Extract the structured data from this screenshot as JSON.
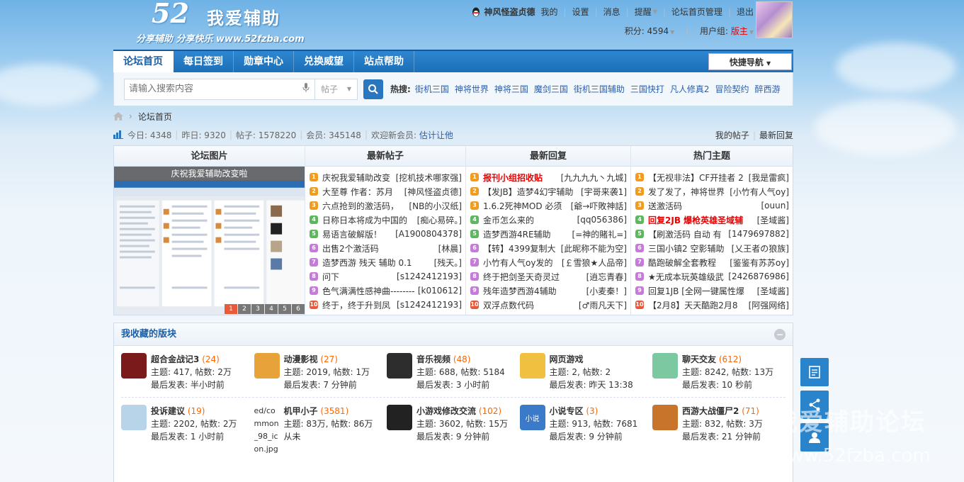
{
  "header": {
    "logo_num": "52",
    "logo_name": "我爱辅助",
    "logo_slogan": "分享辅助 分享快乐 www.52fzba.com",
    "username": "神风怪盗贞德",
    "links": [
      "我的",
      "设置",
      "消息",
      "提醒",
      "论坛首页管理",
      "退出"
    ],
    "points_label": "积分: 4594",
    "usergroup_label": "用户组:",
    "usergroup_value": "版主"
  },
  "nav": {
    "items": [
      "论坛首页",
      "每日签到",
      "勋章中心",
      "兑换威望",
      "站点帮助"
    ],
    "active_index": 0,
    "quick_nav": "快捷导航"
  },
  "search": {
    "placeholder": "请输入搜索内容",
    "type_value": "帖子",
    "hot_label": "热搜:",
    "hot_items": [
      "街机三国",
      "神将世界",
      "神将三国",
      "魔剑三国",
      "街机三国辅助",
      "三国快打",
      "凡人修真2",
      "冒险契约",
      "醉西游"
    ]
  },
  "breadcrumb": {
    "home": "论坛首页"
  },
  "stats": {
    "today": "今日: 4348",
    "yesterday": "昨日: 9320",
    "posts": "帖子: 1578220",
    "members": "会员: 345148",
    "welcome": "欢迎新会员:",
    "new_member": "估计让他",
    "my_posts": "我的帖子",
    "latest_replies": "最新回复"
  },
  "grid": {
    "headers": [
      "论坛图片",
      "最新帖子",
      "最新回复",
      "热门主题"
    ],
    "pic_caption": "庆祝我爱辅助改变啦",
    "pic_pages": [
      "1",
      "2",
      "3",
      "4",
      "5",
      "6"
    ],
    "pic_active_page": 1,
    "latest_posts": [
      {
        "t": "庆祝我爱辅助改变",
        "a": "[挖机技术哪家强]"
      },
      {
        "t": "大至尊 作者：苏月",
        "a": "[神风怪盗贞德]"
      },
      {
        "t": "六点抢到的激活码，",
        "a": "[NB的小汉纸]"
      },
      {
        "t": "日称日本将成为中国的",
        "a": "[痴心易碎。]"
      },
      {
        "t": "易语言破解版！",
        "a": "[A1900804378]"
      },
      {
        "t": "出售2个激活码",
        "a": "[林晨]"
      },
      {
        "t": "造梦西游 残天 辅助 0.1",
        "a": "[残天。]"
      },
      {
        "t": "问下",
        "a": "[s1242412193]"
      },
      {
        "t": "色气满满性感神曲--------",
        "a": "[k010612]"
      },
      {
        "t": "终于，终于升到凤",
        "a": "[s1242412193]"
      }
    ],
    "latest_replies": [
      {
        "t": "报刊小组招收贴",
        "a": "[九九九九丶九城]",
        "red": true
      },
      {
        "t": "【发JB】造梦4幻宇辅助",
        "a": "[宇哥来袭1]"
      },
      {
        "t": "1.6.2死神MOD 必须",
        "a": "[爺→吓敗神話]"
      },
      {
        "t": "金币怎么来的",
        "a": "[qq056386]"
      },
      {
        "t": "造梦西游4RE辅助",
        "a": "[=神的賭礼=]"
      },
      {
        "t": "【转】4399复制大",
        "a": "[此昵称不能为空]"
      },
      {
        "t": "小竹有人气oy发的",
        "a": "[￡雪狼★人品帝]"
      },
      {
        "t": "终于把剑圣天奇灵过",
        "a": "[逍忘青春]"
      },
      {
        "t": "残年造梦西游4辅助",
        "a": "[小麦秦！]"
      },
      {
        "t": "双浮点数代码",
        "a": "[♂雨凡天下]"
      }
    ],
    "hot_topics": [
      {
        "t": "【无视非法】CF开挂者 2",
        "a": "[我是雷疯]"
      },
      {
        "t": "发了发了，神将世界",
        "a": "[小竹有人气oy]"
      },
      {
        "t": "送激活码",
        "a": "[ouun]"
      },
      {
        "t": "回复2JB 爆枪英雄圣域辅",
        "a": "[圣域酱]",
        "red": true
      },
      {
        "t": "【刷激活码 自动 有",
        "a": "[1479697882]"
      },
      {
        "t": "三国小镇2 空影辅助",
        "a": "[乂王者の狼族]"
      },
      {
        "t": "酷跑破解全套教程",
        "a": "[鉴鉴有苏苏oy]"
      },
      {
        "t": "★无成本玩英雄级武",
        "a": "[2426876986]"
      },
      {
        "t": "回复1JB [全网一键属性爆",
        "a": "[圣域酱]"
      },
      {
        "t": "【2月8】天天酷跑2月8",
        "a": "[阿强网络]"
      }
    ],
    "num_colors": [
      "#f29c1f",
      "#f29c1f",
      "#f29c1f",
      "#5cb85c",
      "#5cb85c",
      "#c67ad9",
      "#c67ad9",
      "#c67ad9",
      "#c67ad9",
      "#e8583a"
    ]
  },
  "favorites": {
    "title": "我收藏的版块",
    "rows": [
      [
        {
          "name": "超合金战记3",
          "count": "(24)",
          "line1": "主题: 417, 帖数: 2万",
          "line2": "最后发表: 半小时前",
          "color": "#7a1a1a"
        },
        {
          "name": "动漫影视",
          "count": "(27)",
          "line1": "主题: 2019, 帖数: 1万",
          "line2": "最后发表: 7 分钟前",
          "color": "#e8a23a"
        },
        {
          "name": "音乐视频",
          "count": "(48)",
          "line1": "主题: 688, 帖数: 5184",
          "line2": "最后发表: 3 小时前",
          "color": "#2d2d2d"
        },
        {
          "name": "网页游戏",
          "count": "",
          "line1": "主题: 2, 帖数: 2",
          "line2": "最后发表: 昨天 13:38",
          "color": "#f0c040"
        },
        {
          "name": "聊天交友",
          "count": "(612)",
          "line1": "主题: 8242, 帖数: 13万",
          "line2": "最后发表: 10 秒前",
          "color": "#7cc8a0"
        }
      ],
      [
        {
          "name": "投诉建议",
          "count": "(19)",
          "line1": "主题: 2202, 帖数: 2万",
          "line2": "最后发表: 1 小时前",
          "color": "#b8d4e8"
        },
        {
          "name": "机甲小子",
          "count": "(3581)",
          "line1": "主题: 83万, 帖数: 86万",
          "line2": "从未",
          "alt": "ed/common_98_icon.jpg"
        },
        {
          "name": "小游戏修改交流",
          "count": "(102)",
          "line1": "主题: 3602, 帖数: 15万",
          "line2": "最后发表: 9 分钟前",
          "color": "#222222"
        },
        {
          "name": "小说专区",
          "count": "(3)",
          "line1": "主题: 913, 帖数: 7681",
          "line2": "最后发表: 9 分钟前",
          "color": "#3a7ac8",
          "label": "小说"
        },
        {
          "name": "西游大战僵尸2",
          "count": "(71)",
          "line1": "主题: 832, 帖数: 3万",
          "line2": "最后发表: 21 分钟前",
          "color": "#c8742a"
        }
      ]
    ]
  },
  "watermark": {
    "line1": "我爱辅助论坛",
    "line2": "www.52fzba.com"
  }
}
